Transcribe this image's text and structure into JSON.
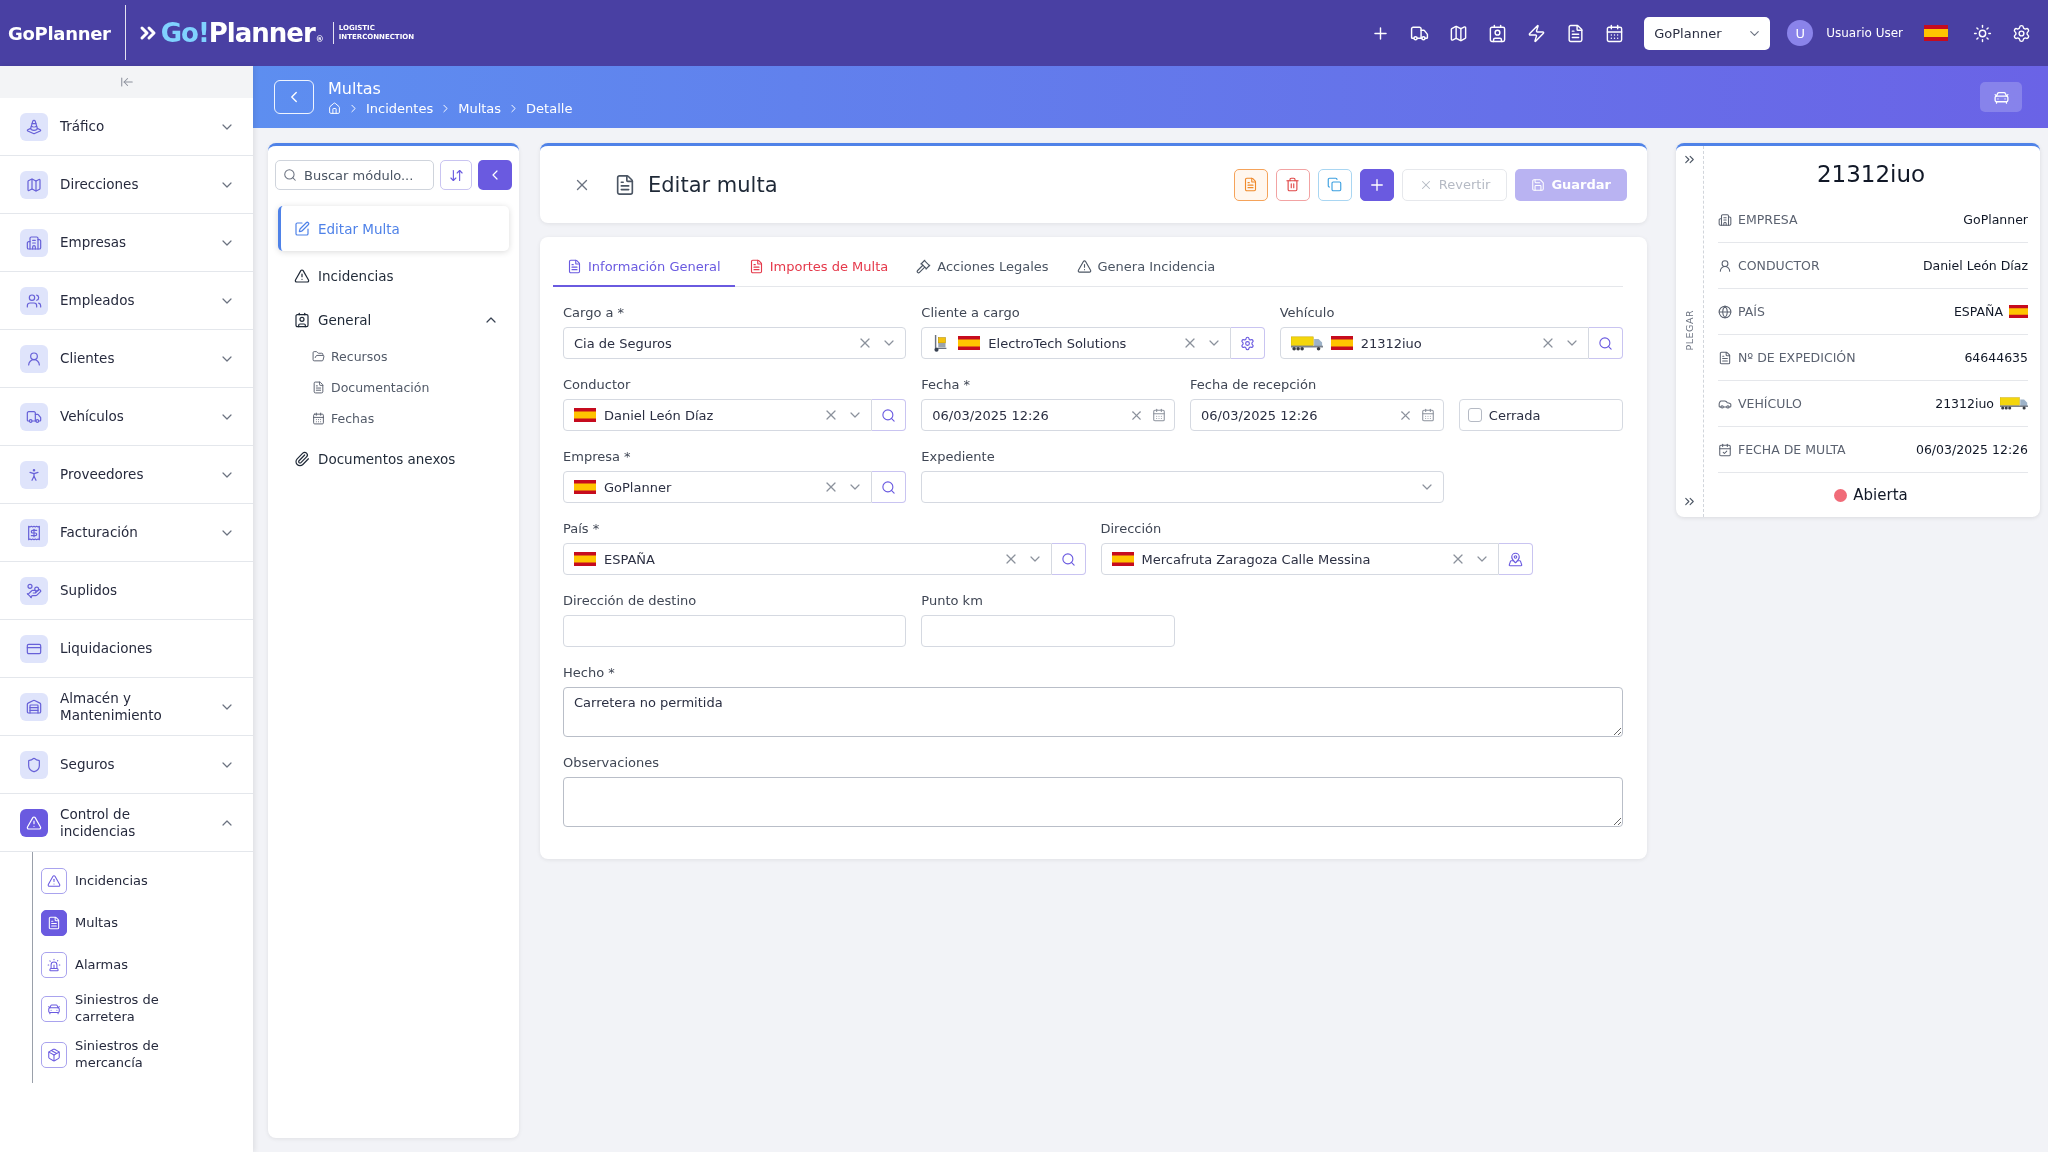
{
  "top_bar": {
    "brand": "GoPlanner",
    "logo": {
      "accent": "Go!",
      "main": "Planner",
      "mark": "®",
      "tagline": "LOGISTIC INTERCONNECTION"
    },
    "company_select": {
      "value": "GoPlanner"
    },
    "user": {
      "initial": "U",
      "name": "Usuario User"
    }
  },
  "sidebar": {
    "items": [
      {
        "label": "Tráfico",
        "expanded": false,
        "selected": false
      },
      {
        "label": "Direcciones",
        "expanded": false,
        "selected": false
      },
      {
        "label": "Empresas",
        "expanded": false,
        "selected": false
      },
      {
        "label": "Empleados",
        "expanded": false,
        "selected": false
      },
      {
        "label": "Clientes",
        "expanded": false,
        "selected": false
      },
      {
        "label": "Vehículos",
        "expanded": false,
        "selected": false
      },
      {
        "label": "Proveedores",
        "expanded": false,
        "selected": false
      },
      {
        "label": "Facturación",
        "expanded": false,
        "selected": false
      },
      {
        "label": "Suplidos",
        "selected": false
      },
      {
        "label": "Liquidaciones",
        "selected": false
      },
      {
        "label": "Almacén y Mantenimiento",
        "expanded": false,
        "selected": false
      },
      {
        "label": "Seguros",
        "expanded": false,
        "selected": false
      },
      {
        "label": "Control de incidencias",
        "expanded": true,
        "selected": true,
        "children": [
          {
            "label": "Incidencias",
            "selected": false
          },
          {
            "label": "Multas",
            "selected": true
          },
          {
            "label": "Alarmas",
            "selected": false
          },
          {
            "label": "Siniestros de carretera",
            "selected": false
          },
          {
            "label": "Siniestros de mercancía",
            "selected": false
          }
        ]
      }
    ]
  },
  "page_header": {
    "title": "Multas",
    "breadcrumb": [
      "Incidentes",
      "Multas",
      "Detalle"
    ]
  },
  "module_panel": {
    "search": {
      "placeholder": "Buscar módulo..."
    },
    "items": [
      {
        "label": "Editar Multa",
        "selected": true
      },
      {
        "label": "Incidencias",
        "selected": false
      },
      {
        "label": "General",
        "selected": false,
        "expanded": true,
        "children": [
          {
            "label": "Recursos"
          },
          {
            "label": "Documentación"
          },
          {
            "label": "Fechas"
          }
        ]
      },
      {
        "label": "Documentos anexos",
        "selected": false
      }
    ]
  },
  "form": {
    "title": "Editar multa",
    "actions": {
      "revert": {
        "label": "Revertir",
        "disabled": true
      },
      "save": {
        "label": "Guardar",
        "disabled": true
      }
    },
    "tabs": [
      {
        "label": "Información General",
        "selected": true,
        "error": false
      },
      {
        "label": "Importes de Multa",
        "selected": false,
        "error": true
      },
      {
        "label": "Acciones Legales",
        "selected": false,
        "error": false
      },
      {
        "label": "Genera Incidencia",
        "selected": false,
        "error": false
      }
    ],
    "rows": [
      [
        {
          "kind": "select",
          "label": "Cargo a *",
          "value": "Cia de Seguros",
          "clearable": true,
          "flag": false
        },
        {
          "kind": "select",
          "label": "Cliente a cargo",
          "value": "ElectroTech Solutions",
          "clearable": true,
          "flag": true,
          "client_image": true,
          "settings_button": true
        },
        {
          "kind": "select",
          "label": "Vehículo",
          "value": "21312iuo",
          "clearable": true,
          "flag": true,
          "vehicle_image": true,
          "search_button": true
        }
      ],
      [
        {
          "kind": "select",
          "label": "Conductor",
          "value": "Daniel León Díaz",
          "clearable": true,
          "flag": true,
          "search_button": true
        },
        {
          "kind": "date",
          "label": "Fecha *",
          "value": "06/03/2025 12:26",
          "clearable": true
        },
        {
          "kind": "date",
          "label": "Fecha de recepción",
          "value": "06/03/2025 12:26",
          "clearable": true
        },
        {
          "kind": "checkbox",
          "label": "Cerrada",
          "checked": false
        }
      ],
      [
        {
          "kind": "select",
          "label": "Empresa *",
          "value": "GoPlanner",
          "clearable": true,
          "flag": true,
          "search_button": true
        },
        {
          "kind": "select",
          "label": "Expediente",
          "clearable": false,
          "flag": false
        }
      ],
      [
        {
          "kind": "select",
          "label": "País *",
          "value": "ESPAÑA",
          "clearable": true,
          "flag": true,
          "search_button": true
        },
        {
          "kind": "select",
          "label": "Dirección",
          "value": "Mercafruta Zaragoza Calle Messina",
          "clearable": true,
          "flag": true,
          "map_button": true
        }
      ],
      [
        {
          "kind": "text",
          "label": "Dirección de destino"
        },
        {
          "kind": "text",
          "label": "Punto km"
        }
      ],
      [
        {
          "kind": "textarea",
          "label": "Hecho *",
          "value": "Carretera no permitida"
        }
      ],
      [
        {
          "kind": "textarea",
          "label": "Observaciones"
        }
      ]
    ]
  },
  "summary": {
    "title": "21312iuo",
    "collapse_label": "PLEGAR",
    "rows": [
      {
        "kind": "text",
        "label": "EMPRESA",
        "value": "GoPlanner"
      },
      {
        "kind": "text",
        "label": "CONDUCTOR",
        "value": "Daniel León Díaz"
      },
      {
        "kind": "flag",
        "label": "PAÍS",
        "value": "ESPAÑA"
      },
      {
        "kind": "text",
        "label": "Nº DE EXPEDICIÓN",
        "value": "64644635"
      },
      {
        "kind": "vehicle",
        "label": "VEHÍCULO",
        "value": "21312iuo"
      },
      {
        "kind": "text",
        "label": "FECHA DE MULTA",
        "value": "06/03/2025 12:26"
      }
    ],
    "status": {
      "label": "Abierta",
      "color": "#f06b78"
    }
  }
}
